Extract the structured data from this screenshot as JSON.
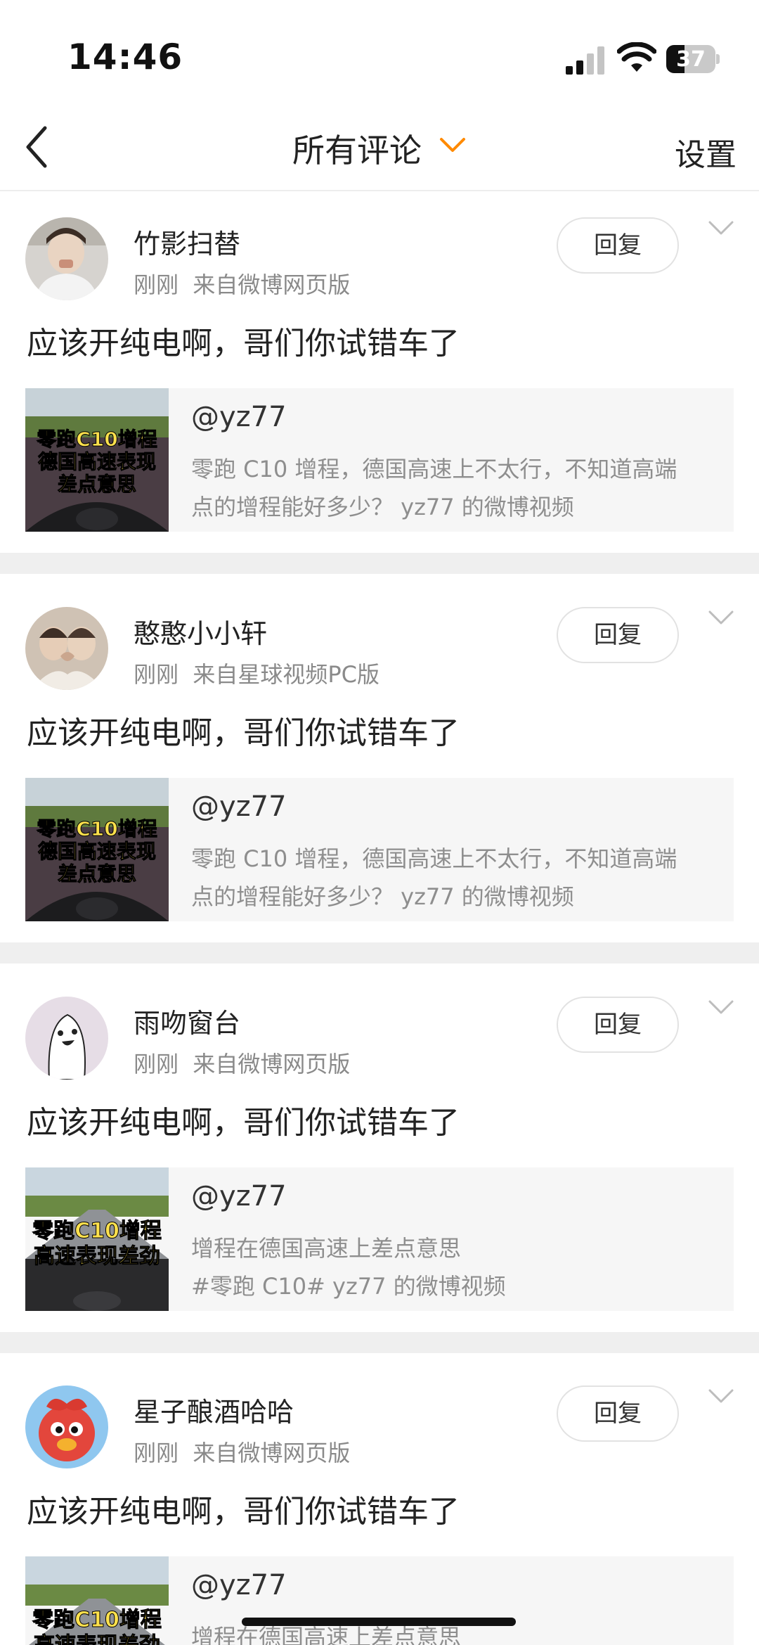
{
  "status_bar": {
    "time": "14:46",
    "battery": "37",
    "battery_level": 0.37
  },
  "nav": {
    "title": "所有评论",
    "settings_label": "设置"
  },
  "comments": [
    {
      "username": "竹影扫替",
      "time": "刚刚",
      "source": "来自微博网页版",
      "reply_label": "回复",
      "text": "应该开纯电啊，哥们你试错车了",
      "share": {
        "title": "@yz77",
        "line1": "零跑 C10 增程，德国高速上不太行，不知道高端",
        "line2": "点的增程能好多少？ yz77 的微博视频",
        "thumb_caption1": "零跑C10增程",
        "thumb_caption2": "德国高速表现",
        "thumb_caption3": "差点意思"
      }
    },
    {
      "username": "憨憨小小轩",
      "time": "刚刚",
      "source": "来自星球视频PC版",
      "reply_label": "回复",
      "text": "应该开纯电啊，哥们你试错车了",
      "share": {
        "title": "@yz77",
        "line1": "零跑 C10 增程，德国高速上不太行，不知道高端",
        "line2": "点的增程能好多少？ yz77 的微博视频",
        "thumb_caption1": "零跑C10增程",
        "thumb_caption2": "德国高速表现",
        "thumb_caption3": "差点意思"
      }
    },
    {
      "username": "雨吻窗台",
      "time": "刚刚",
      "source": "来自微博网页版",
      "reply_label": "回复",
      "text": "应该开纯电啊，哥们你试错车了",
      "share": {
        "title": "@yz77",
        "line1": "增程在德国高速上差点意思",
        "line2": "#零跑 C10# yz77 的微博视频",
        "thumb_caption1": "零跑C10增程",
        "thumb_caption2": "高速表现差劲",
        "thumb_caption3": ""
      }
    },
    {
      "username": "星子酿酒哈哈",
      "time": "刚刚",
      "source": "来自微博网页版",
      "reply_label": "回复",
      "text": "应该开纯电啊，哥们你试错车了",
      "share": {
        "title": "@yz77",
        "line1": "增程在德国高速上差点意思",
        "line2": "",
        "thumb_caption1": "零跑C10增程",
        "thumb_caption2": "高速表现差劲",
        "thumb_caption3": ""
      }
    }
  ]
}
